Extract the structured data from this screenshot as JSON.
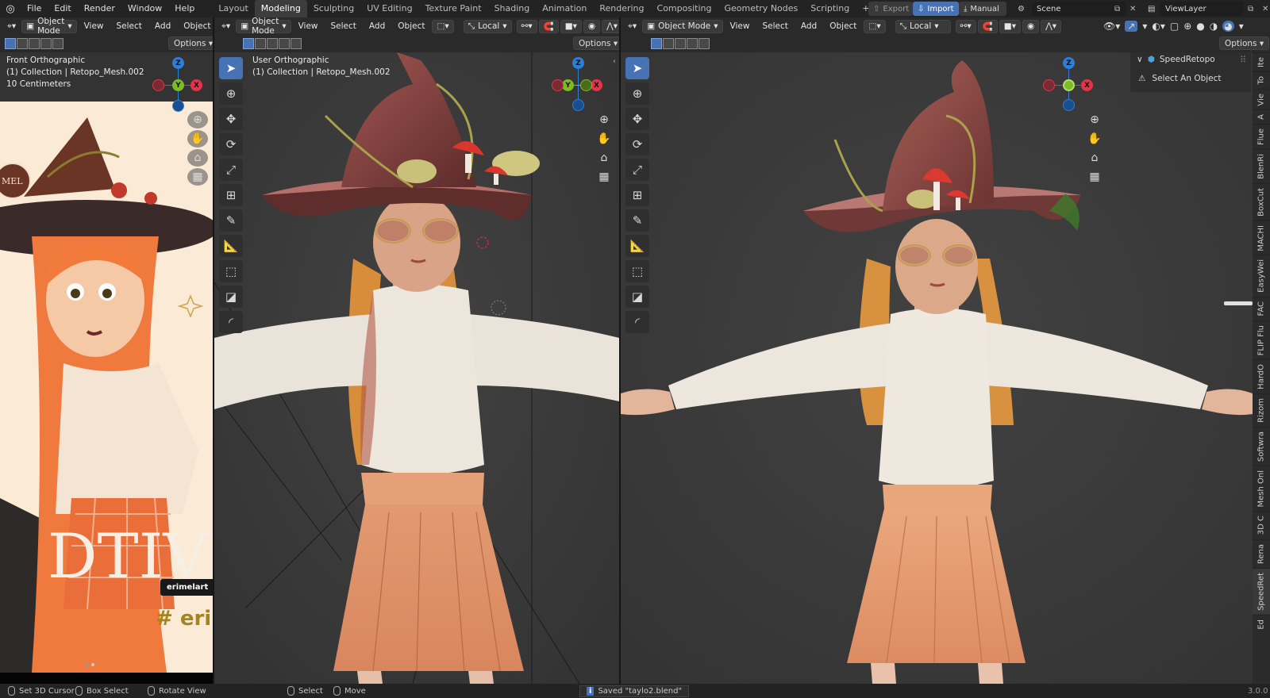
{
  "menu": [
    "File",
    "Edit",
    "Render",
    "Window",
    "Help"
  ],
  "workspaces": [
    "Layout",
    "Modeling",
    "Sculpting",
    "UV Editing",
    "Texture Paint",
    "Shading",
    "Animation",
    "Rendering",
    "Compositing",
    "Geometry Nodes",
    "Scripting"
  ],
  "active_workspace": "Modeling",
  "top_right": {
    "export": "Export",
    "import": "Import",
    "manual": "Manual",
    "scene": "Scene",
    "view_layer": "ViewLayer"
  },
  "left_area": {
    "mode": "Object Mode",
    "menus": [
      "View",
      "Select",
      "Add",
      "Object"
    ],
    "options": "Options",
    "info": {
      "view": "Front Orthographic",
      "collection": "(1) Collection | Retopo_Mesh.002",
      "scale": "10 Centimeters"
    },
    "ref_text": {
      "big": "DTIV",
      "tag": "# eri",
      "badge": "erimelart",
      "logo": "MEL"
    }
  },
  "mid_area": {
    "mode": "Object Mode",
    "menus": [
      "View",
      "Select",
      "Add",
      "Object"
    ],
    "orientation": "Local",
    "options": "Options",
    "info": {
      "view": "User Orthographic",
      "collection": "(1) Collection | Retopo_Mesh.002"
    }
  },
  "right_area": {
    "mode": "Object Mode",
    "menus": [
      "View",
      "Select",
      "Add",
      "Object"
    ],
    "orientation": "Local",
    "options": "Options",
    "panel": {
      "title": "SpeedRetopo",
      "message": "Select An Object"
    },
    "side_tabs": [
      "Ite",
      "To",
      "Vie",
      "A",
      "Flue",
      "BlenRi",
      "BoxCut",
      "MACHI",
      "EasyWei",
      "FAC",
      "FLIP Flu",
      "HardO",
      "Rizom",
      "Softwra",
      "Mesh Onl",
      "3D C",
      "Rena",
      "SpeedRet",
      "Ed"
    ]
  },
  "status": {
    "set_cursor": "Set 3D Cursor",
    "box_select": "Box Select",
    "rotate_view": "Rotate View",
    "select": "Select",
    "move": "Move",
    "saved": "Saved \"taylo2.blend\"",
    "version": "3.0.0"
  },
  "colors": {
    "accent": "#4772b3",
    "x_axis": "#e2354a",
    "y_axis": "#7ebc25",
    "z_axis": "#2b7fd8",
    "viewport_bg": "#3b3b3b"
  }
}
